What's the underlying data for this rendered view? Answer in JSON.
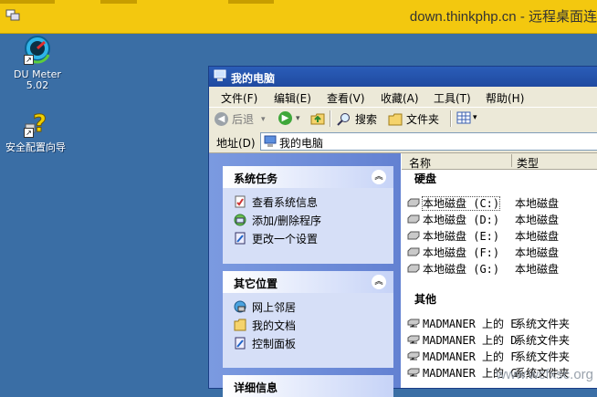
{
  "rdp": {
    "title": "down.thinkphp.cn - 远程桌面连"
  },
  "desktop": {
    "icons": [
      {
        "label": "DU Meter 5.02",
        "icon": "du-meter-icon"
      },
      {
        "label": "安全配置向导",
        "icon": "security-wizard-icon"
      }
    ]
  },
  "window": {
    "title": "我的电脑",
    "menu": [
      "文件(F)",
      "编辑(E)",
      "查看(V)",
      "收藏(A)",
      "工具(T)",
      "帮助(H)"
    ],
    "toolbar": {
      "back": "后退",
      "search": "搜索",
      "folders": "文件夹"
    },
    "address": {
      "label": "地址(D)",
      "value": "我的电脑"
    },
    "panels": [
      {
        "title": "系统任务",
        "items": [
          "查看系统信息",
          "添加/删除程序",
          "更改一个设置"
        ]
      },
      {
        "title": "其它位置",
        "items": [
          "网上邻居",
          "我的文档",
          "控制面板"
        ]
      },
      {
        "title": "详细信息"
      }
    ],
    "columns": {
      "name": "名称",
      "type": "类型"
    },
    "groups": {
      "disk": "硬盘",
      "other": "其他"
    },
    "drives": [
      {
        "name": "本地磁盘 (C:)",
        "type": "本地磁盘"
      },
      {
        "name": "本地磁盘 (D:)",
        "type": "本地磁盘"
      },
      {
        "name": "本地磁盘 (E:)",
        "type": "本地磁盘"
      },
      {
        "name": "本地磁盘 (F:)",
        "type": "本地磁盘"
      },
      {
        "name": "本地磁盘 (G:)",
        "type": "本地磁盘"
      }
    ],
    "shares": [
      {
        "name": "MADMANER 上的 E",
        "type": "系统文件夹"
      },
      {
        "name": "MADMANER 上的 D",
        "type": "系统文件夹"
      },
      {
        "name": "MADMANER 上的 F",
        "type": "系统文件夹"
      },
      {
        "name": "MADMANER 上的 G",
        "type": "系统文件夹"
      }
    ]
  },
  "watermark": "www.wcfxsc.org"
}
